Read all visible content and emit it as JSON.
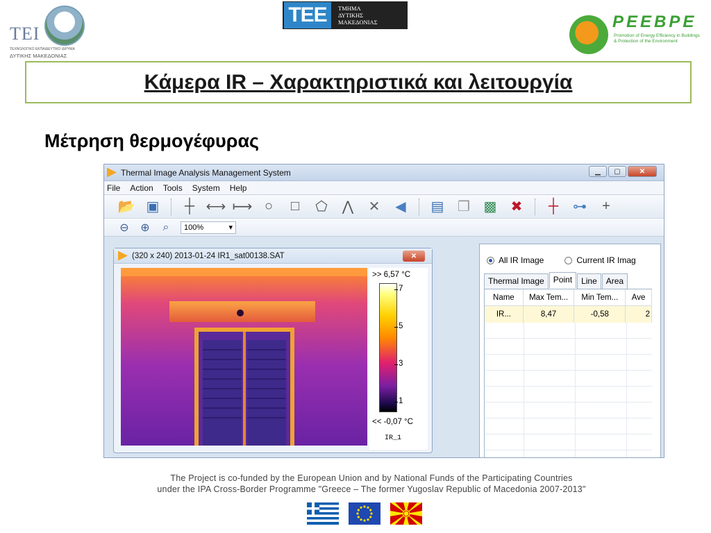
{
  "logos": {
    "tei_letters": "TEI",
    "tei_caption_small": "ΤΕΧΝΟΛΟΓΙΚΟ ΕΚΠΑΙΔΕΥΤΙΚΟ ΙΔΡΥΜΑ",
    "tei_caption": "ΔΥΤΙΚΗΣ ΜΑΚΕΔΟΝΙΑΣ",
    "tee_mark": "TEE",
    "tee_line1": "ΤΜΗΜΑ",
    "tee_line2": "ΔΥΤΙΚΗΣ",
    "tee_line3": "ΜΑΚΕΔΟΝΙΑΣ",
    "peebpe_word": "PEEBPE",
    "peebpe_line1": "Promotion of Energy Efficiency in Buildings",
    "peebpe_line2": "& Protection of the Environment"
  },
  "slide": {
    "title": "Κάμερα IR – Χαρακτηριστικά και λειτουργία",
    "subtitle": "Μέτρηση θερμογέφυρας"
  },
  "app": {
    "window_title": "Thermal Image Analysis Management System",
    "menu": [
      "File",
      "Action",
      "Tools",
      "System",
      "Help"
    ],
    "zoom_value": "100%",
    "image_window": {
      "title": "(320 x 240) 2013-01-24 IR1_sat00138.SAT",
      "scale_max": ">> 6,57 °C",
      "scale_min": "<< -0,07 °C",
      "ticks": [
        "7",
        "5",
        "3",
        "1"
      ],
      "image_name": "IR_1"
    },
    "panel": {
      "radio_all": "All IR Image",
      "radio_current": "Current IR Imag",
      "radio_selected": "All IR Image",
      "tabs": [
        "Thermal Image",
        "Point",
        "Line",
        "Area"
      ],
      "active_tab": "Point",
      "columns": [
        "Name",
        "Max Tem...",
        "Min Tem...",
        "Ave"
      ],
      "rows": [
        {
          "name": "IR...",
          "max": "8,47",
          "min": "-0,58",
          "ave": "2"
        }
      ]
    }
  },
  "footer": {
    "line1": "The Project is co-funded by the European Union and by National Funds of the Participating Countries",
    "line2": "under the IPA Cross-Border Programme \"Greece – The former Yugoslav Republic of Macedonia 2007-2013\""
  },
  "colors": {
    "title_border": "#9bbb59",
    "peebpe_green": "#3aa035",
    "tee_blue": "#2e86c8"
  }
}
